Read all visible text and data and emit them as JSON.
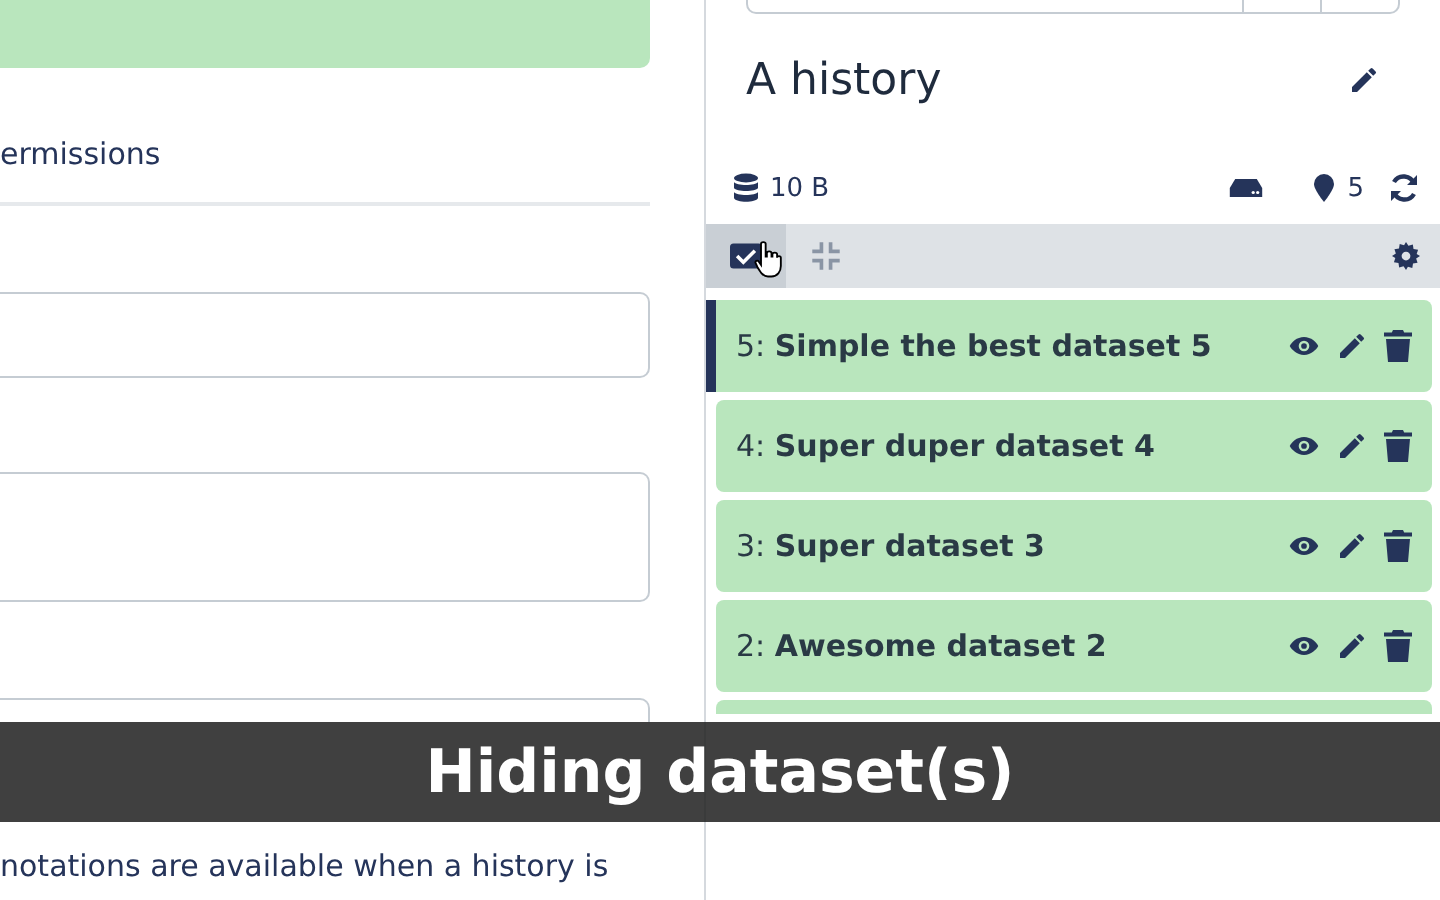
{
  "form": {
    "tab_label": "ermissions",
    "help_text": "notations are available when a history is"
  },
  "history": {
    "title": "A history",
    "size": "10 B",
    "tag_count": "5",
    "datasets": [
      {
        "label": "5: **Simple the best dataset 5**",
        "selected": true
      },
      {
        "label": "4: **Super duper dataset 4**",
        "selected": false
      },
      {
        "label": "3: **Super dataset 3**",
        "selected": false
      },
      {
        "label": "2: **Awesome dataset 2**",
        "selected": false
      }
    ]
  },
  "caption": "Hiding dataset(s)"
}
